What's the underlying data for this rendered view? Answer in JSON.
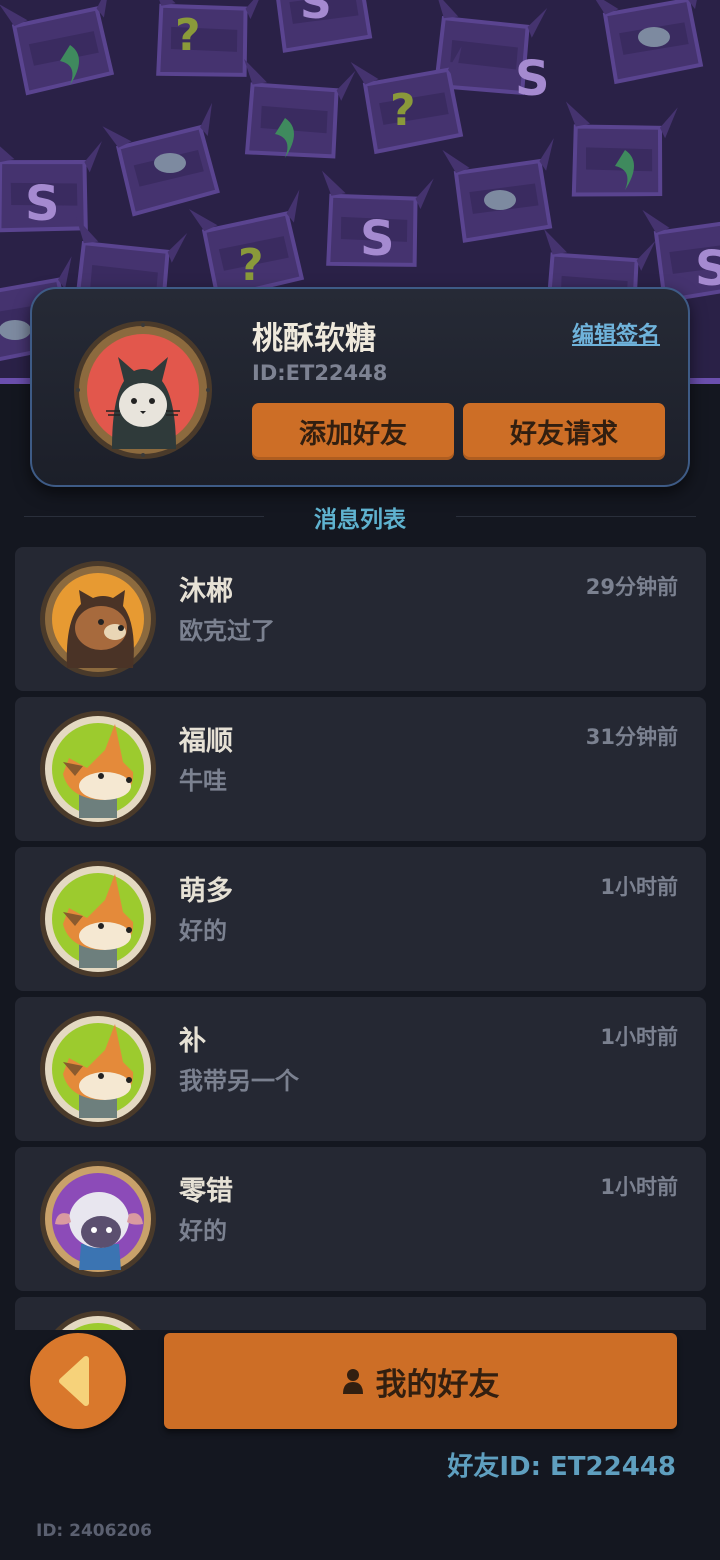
{
  "profile": {
    "name": "桃酥软糖",
    "id": "ID:ET22448",
    "edit_signature": "编辑签名",
    "add_friend": "添加好友",
    "friend_requests": "好友请求",
    "avatar_icon": "gray-cat-hooded-avatar"
  },
  "section": {
    "title": "消息列表"
  },
  "messages": [
    {
      "name": "沐郴",
      "text": "欧克过了",
      "time": "29分钟前",
      "avatar": "bear-avatar"
    },
    {
      "name": "福顺",
      "text": "牛哇",
      "time": "31分钟前",
      "avatar": "fox-avatar"
    },
    {
      "name": "萌多",
      "text": "好的",
      "time": "1小时前",
      "avatar": "fox-avatar"
    },
    {
      "name": "补",
      "text": "我带另一个",
      "time": "1小时前",
      "avatar": "fox-avatar"
    },
    {
      "name": "零错",
      "text": "好的",
      "time": "1小时前",
      "avatar": "sheep-avatar"
    },
    {
      "name": "",
      "text": "",
      "time": "",
      "avatar": "fox-avatar"
    }
  ],
  "bottom": {
    "my_friends": "我的好友",
    "friend_id": "好友ID: ET22448",
    "build_id": "ID: 2406206"
  },
  "colors": {
    "accent_orange": "#cd6e26",
    "header_purple": "#2a2147",
    "link_blue": "#6fb3db"
  }
}
